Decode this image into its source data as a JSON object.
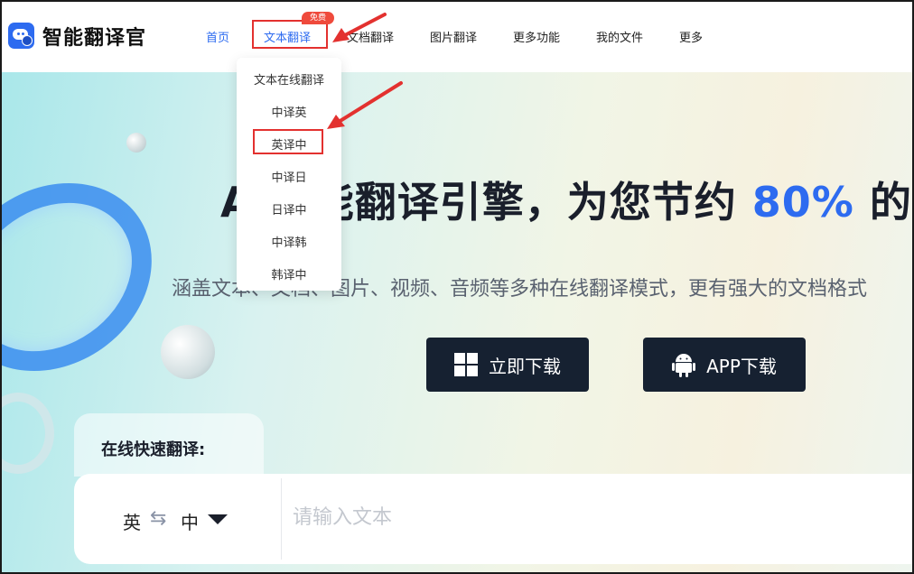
{
  "header": {
    "brand": "智能翻译官",
    "nav": [
      "首页",
      "文本翻译",
      "文档翻译",
      "图片翻译",
      "更多功能",
      "我的文件",
      "更多"
    ],
    "hot_badge": "免费",
    "accent_color": "#2d6bf0"
  },
  "dropdown": {
    "items": [
      "文本在线翻译",
      "中译英",
      "英译中",
      "中译日",
      "日译中",
      "中译韩",
      "韩译中"
    ]
  },
  "hero": {
    "headline_pre": "AI智能翻译引擎，为您节约 ",
    "headline_num": "80%",
    "headline_post": " 的",
    "subline": "涵盖文本、文档、图片、视频、音频等多种在线翻译模式，更有强大的文档格式",
    "btn_download": "立即下载",
    "btn_app": "APP下载"
  },
  "quick_translate": {
    "label": "在线快速翻译:",
    "source_lang": "英",
    "target_lang": "中",
    "placeholder": "请输入文本"
  },
  "annotation_color": "#e3312f"
}
